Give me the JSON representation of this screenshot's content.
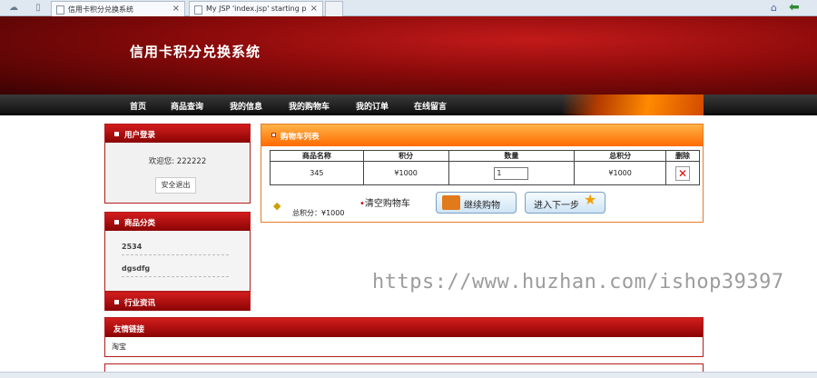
{
  "browser": {
    "tabs": [
      {
        "label": "信用卡积分兑换系统"
      },
      {
        "label": "My JSP 'index.jsp' starting p"
      }
    ]
  },
  "header": {
    "title": "信用卡积分兑换系统"
  },
  "nav": {
    "items": [
      "首页",
      "商品查询",
      "我的信息",
      "我的购物车",
      "我的订单",
      "在线留言"
    ]
  },
  "sidebar": {
    "login": {
      "title": "用户登录",
      "welcome": "欢迎您: 222222",
      "logout_label": "安全退出"
    },
    "categories": {
      "title": "商品分类",
      "items": [
        "2534",
        "dgsdfg"
      ]
    },
    "news": {
      "title": "行业资讯"
    }
  },
  "cart": {
    "title": "购物车列表",
    "columns": [
      "商品名称",
      "积分",
      "数量",
      "总积分",
      "删除"
    ],
    "rows": [
      {
        "name": "345",
        "points": "¥1000",
        "quantity": "1",
        "total": "¥1000"
      }
    ],
    "total_label": "总积分：¥1000",
    "clear_label": "清空购物车",
    "continue_label": "继续购物",
    "next_label": "进入下一步"
  },
  "links": {
    "title": "友情链接",
    "items": [
      "淘宝"
    ]
  },
  "watermark": "https://www.huzhan.com/ishop39397",
  "colors": {
    "brand_red": "#b21c1c",
    "cart_orange": "#ff6a00",
    "nav_dark": "#1e1e1e"
  }
}
